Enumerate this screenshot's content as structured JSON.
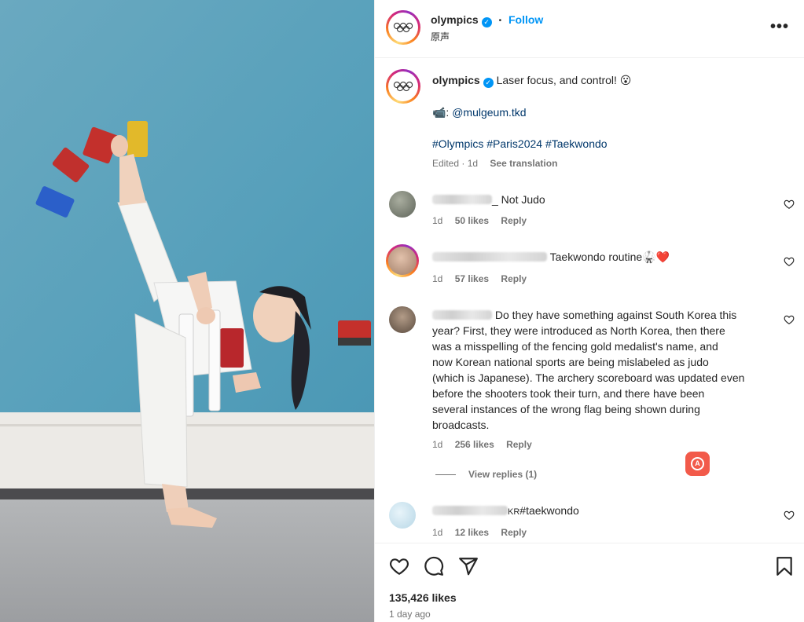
{
  "header": {
    "username": "olympics",
    "verified_glyph": "✓",
    "separator": "•",
    "follow_label": "Follow",
    "audio_label": "原声",
    "more_glyph": "•••"
  },
  "caption": {
    "username": "olympics",
    "text": "Laser focus, and control!",
    "emoji": "😮",
    "credit_prefix": "📹: ",
    "credit_handle": "@mulgeum.tkd",
    "hashtags": "#Olympics #Paris2024 #Taekwondo",
    "edited": "Edited · 1d",
    "see_translation": "See translation"
  },
  "comments": [
    {
      "text": "_ Not Judo",
      "time": "1d",
      "likes": "50 likes",
      "reply": "Reply",
      "avatar_color": "#8a8f82"
    },
    {
      "text": "Taekwondo routine",
      "trail": "🥋❤️",
      "time": "1d",
      "likes": "57 likes",
      "reply": "Reply",
      "avatar_color": "#c9a58d"
    },
    {
      "lines": [
        "Do they have something against South Korea this",
        "year? First, they were introduced as North Korea, then there",
        "was a misspelling of the fencing gold medalist's name, and",
        "now Korean national sports are being mislabeled as judo",
        "(which is Japanese). The archery scoreboard was updated even",
        "before the shooters took their turn, and there have been",
        "several instances of the wrong flag being shown during",
        "broadcasts."
      ],
      "time": "1d",
      "likes": "256 likes",
      "reply": "Reply",
      "view_replies": "View replies (1)",
      "avatar_color": "#8c7a6a"
    },
    {
      "prefix": "KR",
      "text": "#taekwondo",
      "time": "1d",
      "likes": "12 likes",
      "reply": "Reply",
      "avatar_color": "#cfe6f0"
    }
  ],
  "footer": {
    "likes": "135,426 likes",
    "time_ago": "1 day ago"
  },
  "ai_badge": "A",
  "icons": [
    "like-icon",
    "comment-icon",
    "share-icon",
    "save-icon",
    "more-options-icon",
    "verified-badge-icon",
    "olympic-rings-icon"
  ],
  "colors": {
    "accent": "#0095f6",
    "text": "#262626",
    "muted": "#737373",
    "like": "#ed4956",
    "ai_badge": "#f25a4a"
  }
}
